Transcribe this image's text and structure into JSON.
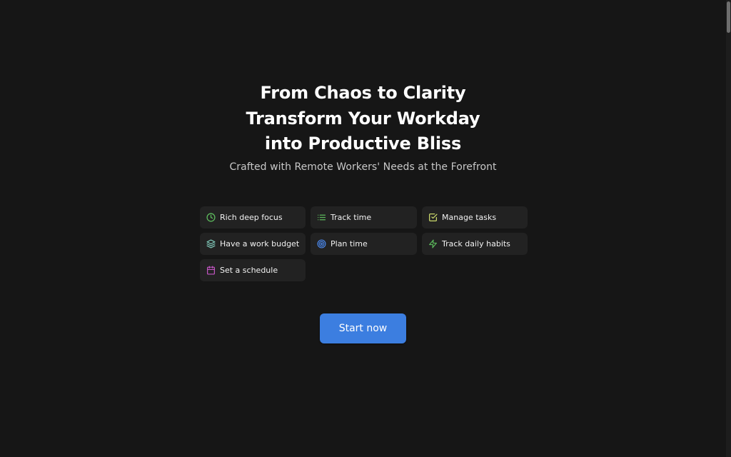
{
  "hero": {
    "title_line_1": "From Chaos to Clarity",
    "title_line_2": "Transform Your Workday",
    "title_line_3": "into Productive Bliss",
    "subtitle": "Crafted with Remote Workers' Needs at the Forefront"
  },
  "features": [
    {
      "label": "Rich deep focus",
      "icon": "clock-icon",
      "color": "#5cb85c"
    },
    {
      "label": "Track time",
      "icon": "list-icon",
      "color": "#5cb85c"
    },
    {
      "label": "Manage tasks",
      "icon": "checkbox-icon",
      "color": "#c8d66a"
    },
    {
      "label": "Have a work budget",
      "icon": "layers-icon",
      "color": "#7fc7b8"
    },
    {
      "label": "Plan time",
      "icon": "target-icon",
      "color": "#4a86e8"
    },
    {
      "label": "Track daily habits",
      "icon": "lightning-icon",
      "color": "#5cb85c"
    },
    {
      "label": "Set a schedule",
      "icon": "calendar-icon",
      "color": "#c456c4"
    }
  ],
  "cta": {
    "label": "Start now",
    "color": "#3c7ee0"
  },
  "colors": {
    "background": "#161616",
    "card": "#222222"
  }
}
